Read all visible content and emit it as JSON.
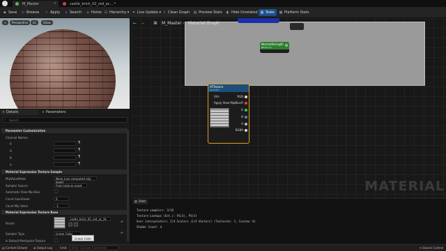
{
  "tabs": [
    {
      "label": "M_Master",
      "dot": "#5db85d"
    },
    {
      "label": "castle_brick_02_red_ac...",
      "dot": "#d04545"
    }
  ],
  "toolbar": {
    "save": "Save",
    "browse": "Browse",
    "apply": "Apply",
    "search": "Search",
    "home": "Home",
    "hierarchy": "Hierarchy",
    "live_update": "Live Update",
    "clean_graph": "Clean Graph",
    "preview_stats": "Preview Stats",
    "hide_unrelated": "Hide Unrelated",
    "stats": "Stats",
    "platform_stats": "Platform Stats"
  },
  "viewport": {
    "perspective": "Perspective",
    "lit": "Lit",
    "show": "Show"
  },
  "panels": {
    "details_tab": "Details",
    "parameters_tab": "Parameters",
    "search_placeholder": "Search",
    "param_customization": "Parameter Customization",
    "channel_names": "Channel Names",
    "channels": [
      "R",
      "G",
      "B",
      "A"
    ],
    "tex_sample_section": "Material Expression Texture Sample",
    "mip_mode_label": "MipValueMode",
    "mip_mode_value": "None (use computed mip level)",
    "sampler_source_label": "Sampler Source",
    "sampler_source_value": "From texture asset",
    "auto_mip_label": "Automatic View Mip Bias",
    "const_coord_label": "Const Coordinate",
    "const_coord_value": "0",
    "const_mip_label": "Const Mip Value",
    "const_mip_value": "-1",
    "tex_base_section": "Material Expression Texture Base",
    "param_label": "Param",
    "param_texture": "castle_brick_02_red_ac_2k",
    "sampler_type_label": "Sampler Type",
    "sampler_type_value": "Linear Color",
    "default_meshpaint_label": "Is Default Meshpaint Texture"
  },
  "graph": {
    "breadcrumb": "M_Master",
    "title": "Material Graph",
    "node_normal_title": "NormalStrength",
    "node_normal_sub": "Param (1)",
    "node_tex_title": "ATTexture",
    "node_tex_sub": "Param2D",
    "node_tex_pins_left": [
      "UVs",
      "Apply View MipBias"
    ],
    "node_tex_pins_right": [
      "RGB",
      "R",
      "G",
      "B",
      "A",
      "RGBA"
    ],
    "watermark": "MATERIAL"
  },
  "stats": {
    "title": "Stats",
    "lines": [
      "Texture samplers: 3/16",
      "Texture Lookups (Est.): VS(3), PS(3)",
      "User interpolators: 2/4 Scalars (1/4 Vectors) (TexCoords: 2, Custom: 0)",
      "Shader Count: 4"
    ]
  },
  "statusbar": {
    "content_drawer": "Content Drawer",
    "output_log": "Output Log",
    "cmd": "Cmd",
    "console_placeholder": "Enter Console Command",
    "source_control": "Source Control"
  },
  "tooltip": "Linear Color"
}
